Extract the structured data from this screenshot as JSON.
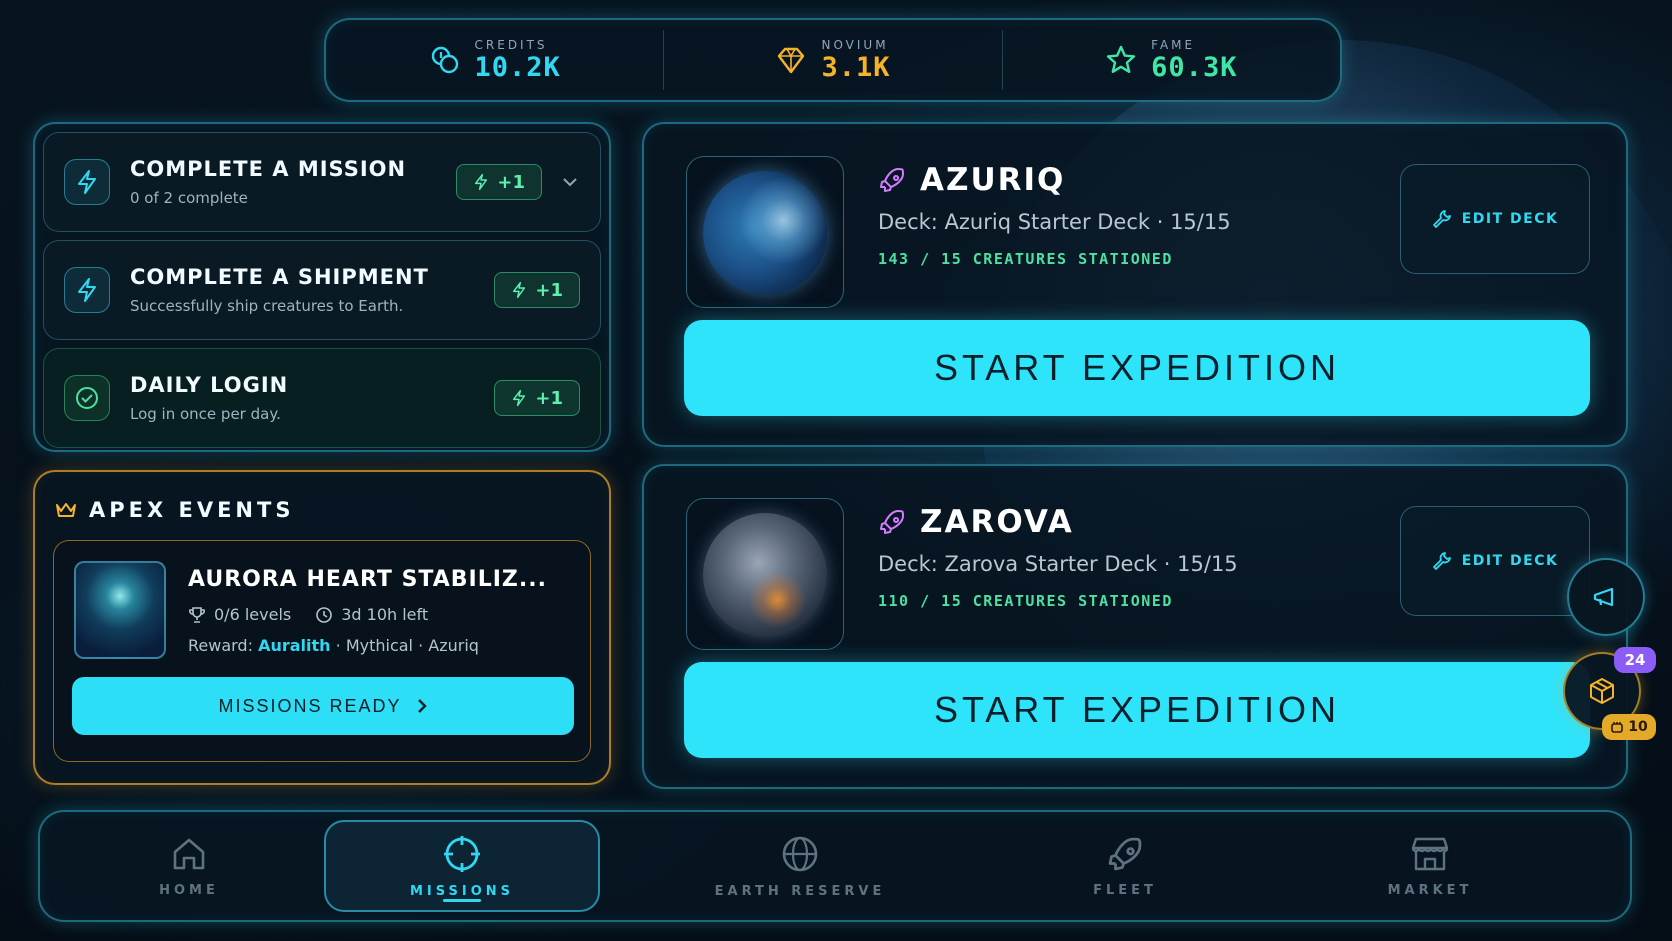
{
  "resources": [
    {
      "label": "CREDITS",
      "value": "10.2K",
      "icon": "coins-icon",
      "color": "#30d8f2"
    },
    {
      "label": "NOVIUM",
      "value": "3.1K",
      "icon": "diamond-icon",
      "color": "#f5b32a"
    },
    {
      "label": "FAME",
      "value": "60.3K",
      "icon": "star-icon",
      "color": "#3fe6a6"
    }
  ],
  "tasks": [
    {
      "title": "COMPLETE A MISSION",
      "subtitle": "0 of 2 complete",
      "reward": "+1",
      "icon": "lightning-icon",
      "expandable": true
    },
    {
      "title": "COMPLETE A SHIPMENT",
      "subtitle": "Successfully ship creatures to Earth.",
      "reward": "+1",
      "icon": "lightning-icon"
    },
    {
      "title": "DAILY LOGIN",
      "subtitle": "Log in once per day.",
      "reward": "+1",
      "icon": "check-circle-icon",
      "done": true
    }
  ],
  "apex": {
    "header": "APEX EVENTS",
    "event_name": "AURORA HEART STABILIZ...",
    "levels": "0/6 levels",
    "time_left": "3d 10h left",
    "reward_prefix": "Reward:",
    "reward_name": "Auralith",
    "reward_suffix": "· Mythical · Azuriq",
    "button_label": "MISSIONS READY"
  },
  "expeditions": [
    {
      "name": "AZURIQ",
      "deck": "Deck: Azuriq Starter Deck · 15/15",
      "stationed": "143 / 15 CREATURES STATIONED",
      "edit_label": "EDIT DECK",
      "start_label": "START EXPEDITION"
    },
    {
      "name": "ZAROVA",
      "deck": "Deck: Zarova Starter Deck · 15/15",
      "stationed": "110 / 15 CREATURES STATIONED",
      "edit_label": "EDIT DECK",
      "start_label": "START EXPEDITION"
    }
  ],
  "floating": {
    "box_badge": "24",
    "gold_badge": "10"
  },
  "nav": [
    {
      "label": "HOME",
      "icon": "home-icon",
      "active": false
    },
    {
      "label": "MISSIONS",
      "icon": "crosshair-icon",
      "active": true
    },
    {
      "label": "EARTH RESERVE",
      "icon": "globe-icon",
      "active": false
    },
    {
      "label": "FLEET",
      "icon": "rocket-icon",
      "active": false
    },
    {
      "label": "MARKET",
      "icon": "store-icon",
      "active": false
    }
  ]
}
